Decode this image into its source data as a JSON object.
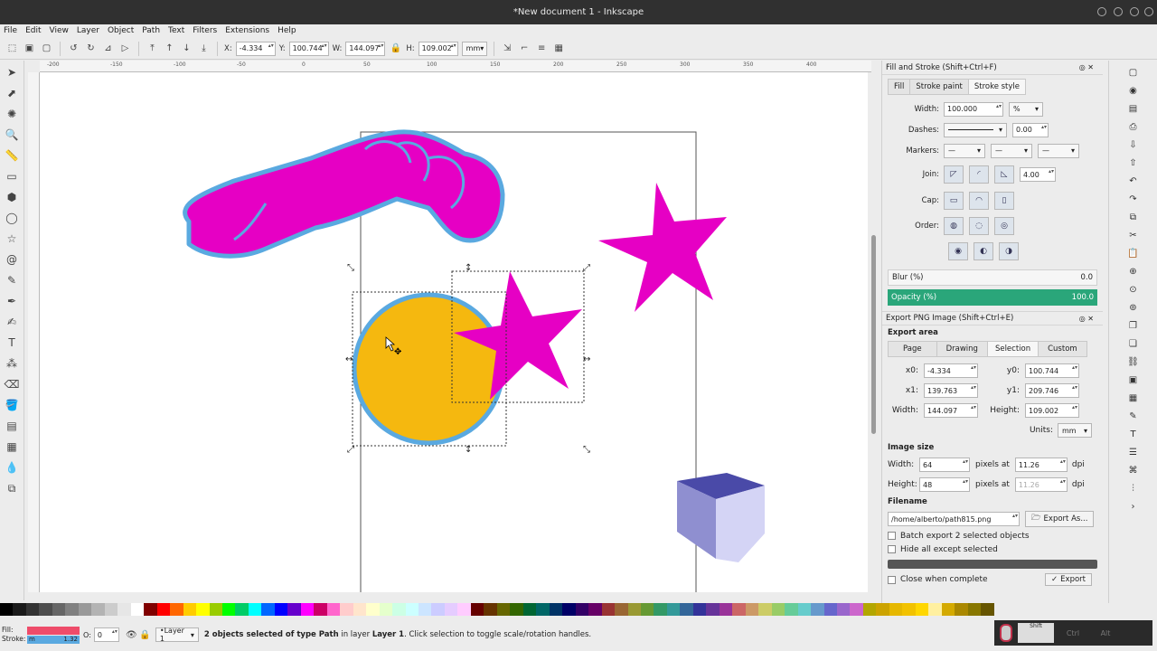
{
  "window": {
    "title": "*New document 1 - Inkscape"
  },
  "menu": [
    "File",
    "Edit",
    "View",
    "Layer",
    "Object",
    "Path",
    "Text",
    "Filters",
    "Extensions",
    "Help"
  ],
  "controls": {
    "x_label": "X:",
    "x": "-4.334",
    "y_label": "Y:",
    "y": "100.744",
    "w_label": "W:",
    "w": "144.097",
    "h_label": "H:",
    "h": "109.002",
    "units": "mm"
  },
  "ruler": [
    "-200",
    "-150",
    "-100",
    "-50",
    "0",
    "50",
    "100",
    "150",
    "200",
    "250",
    "300",
    "350",
    "400"
  ],
  "fill_stroke": {
    "title": "Fill and Stroke (Shift+Ctrl+F)",
    "tabs": [
      "Fill",
      "Stroke paint",
      "Stroke style"
    ],
    "width_label": "Width:",
    "width": "100.000",
    "width_unit": "%",
    "dashes_label": "Dashes:",
    "dash_offset": "0.00",
    "markers_label": "Markers:",
    "markers": [
      "—",
      "—",
      "—"
    ],
    "join_label": "Join:",
    "miter": "4.00",
    "cap_label": "Cap:",
    "order_label": "Order:",
    "blur_label": "Blur (%)",
    "blur": "0.0",
    "opacity_label": "Opacity (%)",
    "opacity": "100.0"
  },
  "export_png": {
    "title": "Export PNG Image (Shift+Ctrl+E)",
    "area_label": "Export area",
    "area_tabs": [
      "Page",
      "Drawing",
      "Selection",
      "Custom"
    ],
    "x0_label": "x0:",
    "x0": "-4.334",
    "y0_label": "y0:",
    "y0": "100.744",
    "x1_label": "x1:",
    "x1": "139.763",
    "y1_label": "y1:",
    "y1": "209.746",
    "width_label": "Width:",
    "width": "144.097",
    "height_label": "Height:",
    "height": "109.002",
    "units_label": "Units:",
    "units": "mm",
    "size_label": "Image size",
    "img_width_label": "Width:",
    "img_width": "64",
    "img_height_label": "Height:",
    "img_height": "48",
    "pixels_at": "pixels at",
    "dpi_value": "11.26",
    "dpi_value2": "11.26",
    "dpi": "dpi",
    "filename_label": "Filename",
    "filename": "/home/alberto/path815.png",
    "export_as": "Export As...",
    "batch": "Batch export 2 selected objects",
    "hide_all": "Hide all except selected",
    "close_when": "Close when complete",
    "export_btn": "Export"
  },
  "status": {
    "fill_label": "Fill:",
    "stroke_label": "Stroke:",
    "stroke_value": "m",
    "stroke_width": "1.32",
    "opacity_label": "O:",
    "opacity": "0",
    "layer": "•Layer 1",
    "message_pre": "2 objects selected of type ",
    "message_type": "Path",
    "message_mid": " in layer ",
    "message_layer": "Layer 1",
    "message_post": ". Click selection to toggle scale/rotation handles.",
    "ctrl": "Ctrl",
    "alt": "Alt",
    "shift": "Shift"
  },
  "colors": {
    "magenta": "#e600c4",
    "orange": "#f5b80f",
    "stroke_blue": "#5aa9e0",
    "cube_top": "#4a4aa8",
    "cube_left": "#8f8fd0",
    "cube_right": "#d4d4f5",
    "opacity_bar": "#2aa67a",
    "fill_swatch": "#ee4c6a"
  },
  "palette": [
    "#000000",
    "#1a1a1a",
    "#333333",
    "#4d4d4d",
    "#666666",
    "#808080",
    "#999999",
    "#b3b3b3",
    "#cccccc",
    "#e6e6e6",
    "#ffffff",
    "#800000",
    "#ff0000",
    "#ff6600",
    "#ffcc00",
    "#ffff00",
    "#99cc00",
    "#00ff00",
    "#00cc66",
    "#00ffff",
    "#0066ff",
    "#0000ff",
    "#6600cc",
    "#ff00ff",
    "#cc0066",
    "#ff66cc",
    "#ffcccc",
    "#ffe5cc",
    "#ffffcc",
    "#e5ffcc",
    "#ccffe5",
    "#ccffff",
    "#cce5ff",
    "#ccccff",
    "#e5ccff",
    "#ffccff",
    "#660000",
    "#663300",
    "#666600",
    "#336600",
    "#006633",
    "#006666",
    "#003366",
    "#000066",
    "#330066",
    "#660066",
    "#993333",
    "#996633",
    "#999933",
    "#669933",
    "#339966",
    "#339999",
    "#336699",
    "#333399",
    "#663399",
    "#993399",
    "#cc6666",
    "#cc9966",
    "#cccc66",
    "#99cc66",
    "#66cc99",
    "#66cccc",
    "#6699cc",
    "#6666cc",
    "#9966cc",
    "#cc66cc",
    "#b3a600",
    "#cca300",
    "#e6b800",
    "#f2c200",
    "#ffd700",
    "#fff0a0",
    "#d4aa00",
    "#aa8800",
    "#887700",
    "#665500"
  ]
}
